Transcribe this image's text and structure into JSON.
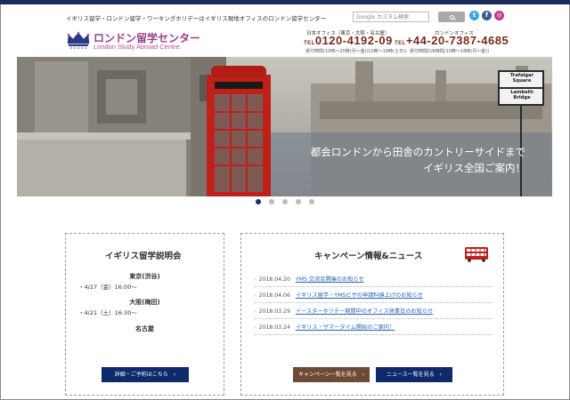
{
  "header": {
    "tagline": "イギリス留学・ロンドン留学・ワーキングホリデーはイギリス現地オフィスのロンドン留学センター",
    "search_placeholder": "Google カスタム検索",
    "social": [
      "twitter-icon",
      "facebook-icon",
      "instagram-icon"
    ],
    "logo_jp": "ロンドン留学センター",
    "logo_en": "London Study Abroad Centre",
    "japan_office": {
      "label": "日本オフィス（東京・大阪・名古屋）",
      "tel_prefix": "TEL",
      "number": "0120-4192-09",
      "hours": "受付時間(10時〜20時(月〜金)/10時〜19時(土日))"
    },
    "london_office": {
      "label": "ロンドンオフィス",
      "tel_prefix": "TEL",
      "number": "+44-20-7387-4685",
      "hours": "受付時間(UK時間/10時〜18時(月〜金))"
    }
  },
  "hero": {
    "line1": "都会ロンドンから田舎のカントリーサイドまで",
    "line2": "イギリス全国ご案内！",
    "signs": [
      "Trafalgar Square",
      "Lambeth Bridge"
    ],
    "slides": 5,
    "active_slide": 1
  },
  "seminar": {
    "title": "イギリス留学説明会",
    "venues": [
      {
        "name": "東京(渋谷)",
        "dates": [
          "4/27（金）16:00〜"
        ]
      },
      {
        "name": "大阪(梅田)",
        "dates": [
          "4/21（土）16:30〜"
        ]
      },
      {
        "name": "名古屋",
        "dates": []
      }
    ],
    "button": "詳細・ご予約はこちら"
  },
  "news": {
    "title": "キャンペーン情報&ニュース",
    "items": [
      {
        "date": "2018.04.20",
        "text": "YMS 交流会開催のお知らせ"
      },
      {
        "date": "2018.04.06",
        "text": "イギリス留学・YMSビザの申請料値上げのお知らせ"
      },
      {
        "date": "2018.03.29",
        "text": "イースターホリデー期間中のオフィス休業日のお知らせ"
      },
      {
        "date": "2018.03.24",
        "text": "イギリス・サマータイム開始のご案内！"
      }
    ],
    "campaign_button": "キャンペーン一覧を見る",
    "news_button": "ニュース一覧を見る"
  },
  "colors": {
    "navy": "#0f2a6b",
    "brown": "#6e4a35",
    "logo_purple": "#9b3f8f",
    "phone_red": "#7b2a1e",
    "link_blue": "#2a62b5"
  }
}
